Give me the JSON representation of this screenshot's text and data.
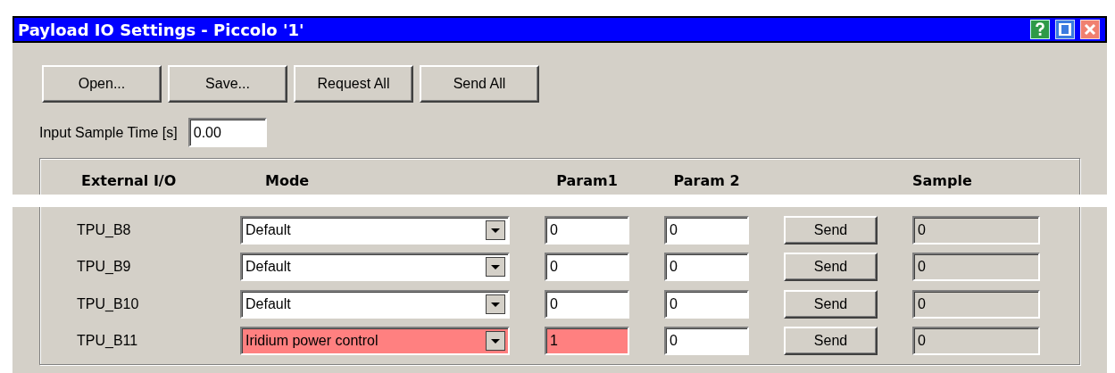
{
  "window": {
    "title": "Payload IO Settings - Piccolo '1'"
  },
  "toolbar": {
    "buttons": [
      "Open...",
      "Save...",
      "Request All",
      "Send All"
    ]
  },
  "input_sample_time": {
    "label": "Input Sample Time [s]",
    "value": "0.00"
  },
  "table": {
    "columns": [
      "External I/O",
      "Mode",
      "Param1",
      "Param 2",
      "Sample"
    ],
    "rows": [
      {
        "name": "TPU_B8",
        "mode": {
          "value": "Default",
          "highlighted": false
        },
        "param1": {
          "value": "0",
          "highlighted": false
        },
        "param2": {
          "value": "0",
          "highlighted": false
        },
        "button": "Send",
        "sample": "0"
      },
      {
        "name": "TPU_B9",
        "mode": {
          "value": "Default",
          "highlighted": false
        },
        "param1": {
          "value": "0",
          "highlighted": false
        },
        "param2": {
          "value": "0",
          "highlighted": false
        },
        "button": "Send",
        "sample": "0"
      },
      {
        "name": "TPU_B10",
        "mode": {
          "value": "Default",
          "highlighted": false
        },
        "param1": {
          "value": "0",
          "highlighted": false
        },
        "param2": {
          "value": "0",
          "highlighted": false
        },
        "button": "Send",
        "sample": "0"
      },
      {
        "name": "TPU_B11",
        "mode": {
          "value": "Iridium power control",
          "highlighted": true
        },
        "param1": {
          "value": "1",
          "highlighted": true
        },
        "param2": {
          "value": "0",
          "highlighted": false
        },
        "button": "Send",
        "sample": "0"
      }
    ]
  }
}
